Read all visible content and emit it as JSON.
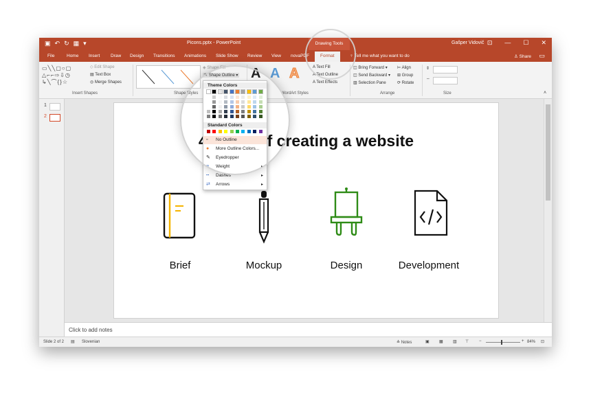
{
  "titlebar": {
    "document_title": "Picons.pptx - PowerPoint",
    "context_tab": "Drawing Tools",
    "user": "Gašper Vidovič",
    "minimize": "—",
    "restore": "☐",
    "close": "✕"
  },
  "tabs": [
    "File",
    "Home",
    "Insert",
    "Draw",
    "Design",
    "Transitions",
    "Animations",
    "Slide Show",
    "Review",
    "View",
    "novaPDF",
    "Format"
  ],
  "active_tab": "Format",
  "tell_me": "Tell me what you want to do",
  "share_label": "Share",
  "ribbon": {
    "insert_shapes": {
      "label": "Insert Shapes",
      "edit_shape": "Edit Shape",
      "text_box": "Text Box",
      "merge_shapes": "Merge Shapes"
    },
    "shape_styles": {
      "label": "Shape Styles",
      "shape_fill": "Shape Fill",
      "shape_outline": "Shape Outline"
    },
    "wordart": {
      "label": "WordArt Styles",
      "text_fill": "Text Fill",
      "text_outline": "Text Outline",
      "text_effects": "Text Effects",
      "sample": "A"
    },
    "arrange": {
      "label": "Arrange",
      "bring_forward": "Bring Forward",
      "send_backward": "Send Backward",
      "selection_pane": "Selection Pane",
      "align": "Align",
      "group": "Group",
      "rotate": "Rotate"
    },
    "size": {
      "label": "Size"
    }
  },
  "outline_menu": {
    "theme_colors_label": "Theme Colors",
    "standard_colors_label": "Standard Colors",
    "no_outline": "No Outline",
    "more_colors": "More Outline Colors...",
    "eyedropper": "Eyedropper",
    "weight": "Weight",
    "dashes": "Dashes",
    "arrows": "Arrows",
    "theme_top": [
      "#ffffff",
      "#000000",
      "#e7e6e6",
      "#44546a",
      "#4472c4",
      "#ed7d31",
      "#a5a5a5",
      "#ffc000",
      "#5b9bd5",
      "#70ad47"
    ],
    "standard": [
      "#c00000",
      "#ff0000",
      "#ffc000",
      "#ffff00",
      "#92d050",
      "#00b050",
      "#00b0f0",
      "#0070c0",
      "#002060",
      "#7030a0"
    ]
  },
  "thumbnails": [
    {
      "num": "1"
    },
    {
      "num": "2"
    }
  ],
  "slide": {
    "title": "4 steps of creating a website",
    "labels": [
      "Brief",
      "Mockup",
      "Design",
      "Development"
    ],
    "colors": {
      "brief_accent": "#f5b400",
      "design_green": "#2e8b16",
      "icon_black": "#111111"
    }
  },
  "notes_placeholder": "Click to add notes",
  "status": {
    "slide_info": "Slide 2 of 2",
    "language": "Slovenian",
    "notes": "Notes",
    "zoom": "84%"
  },
  "accent_color": "#b7472a"
}
